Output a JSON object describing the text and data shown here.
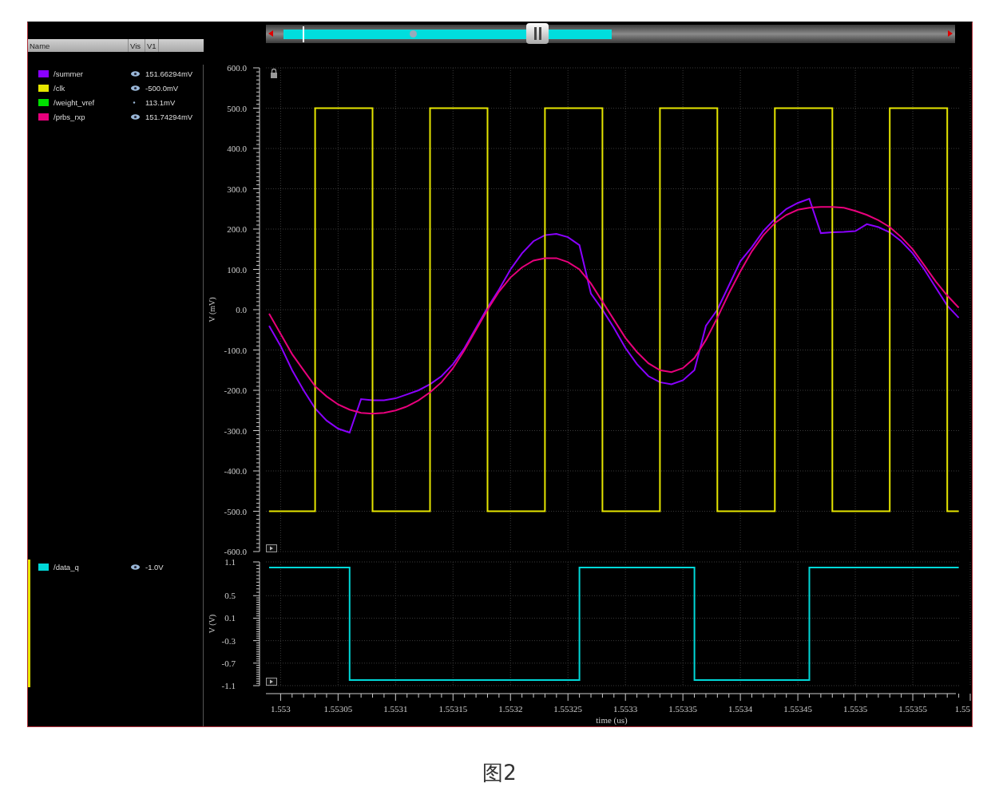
{
  "figure": {
    "legend": {
      "columns": [
        "Name",
        "Vis",
        "V1"
      ],
      "groups": [
        {
          "selected": false,
          "signals": [
            {
              "name": "/summer",
              "color": "#8a00ff",
              "visible": true,
              "value": "151.66294mV"
            },
            {
              "name": "/clk",
              "color": "#e6e600",
              "visible": true,
              "value": "-500.0mV"
            },
            {
              "name": "/weight_vref",
              "color": "#00e000",
              "visible": false,
              "value": "113.1mV"
            },
            {
              "name": "/prbs_rxp",
              "color": "#e8007c",
              "visible": true,
              "value": "151.74294mV"
            }
          ]
        },
        {
          "selected": true,
          "signals": [
            {
              "name": "/data_q",
              "color": "#00d8d8",
              "visible": true,
              "value": "-1.0V"
            }
          ]
        }
      ]
    },
    "top_chart": {
      "chart_data": {
        "type": "line",
        "grid": true,
        "ylabel": "V (mV)",
        "x": [
          1.55299,
          1.553,
          1.55301,
          1.55302,
          1.55303,
          1.55303,
          1.55304,
          1.55305,
          1.55306,
          1.55307,
          1.55308,
          1.55308,
          1.55309,
          1.5531,
          1.55311,
          1.55312,
          1.55313,
          1.55313,
          1.55314,
          1.55315,
          1.55316,
          1.55317,
          1.55318,
          1.55318,
          1.55319,
          1.5532,
          1.55321,
          1.55322,
          1.55323,
          1.55323,
          1.55324,
          1.55325,
          1.55326,
          1.55327,
          1.55328,
          1.55328,
          1.55329,
          1.5533,
          1.55331,
          1.55332,
          1.55333,
          1.55333,
          1.55334,
          1.55335,
          1.55336,
          1.55337,
          1.55338,
          1.55338,
          1.55339,
          1.5534,
          1.55341,
          1.55342,
          1.55343,
          1.55343,
          1.55344,
          1.55345,
          1.55346,
          1.55347,
          1.55348,
          1.55348,
          1.55349,
          1.5535,
          1.55351,
          1.55352,
          1.55353,
          1.55353,
          1.55354,
          1.55355,
          1.55356,
          1.55357,
          1.55358,
          1.55358,
          1.55359
        ],
        "series": [
          {
            "color": "#8a00ff",
            "values": [
              -40,
              -90,
              -150,
              -200,
              -245,
              -245,
              -275,
              -295,
              -305,
              -222,
              -225,
              -225,
              -225,
              -220,
              -210,
              -200,
              -185,
              -185,
              -165,
              -135,
              -95,
              -45,
              5,
              5,
              50,
              100,
              140,
              170,
              185,
              185,
              188,
              180,
              160,
              40,
              0,
              0,
              -45,
              -95,
              -135,
              -165,
              -180,
              -180,
              -185,
              -175,
              -150,
              -40,
              0,
              0,
              60,
              120,
              155,
              195,
              225,
              225,
              250,
              265,
              275,
              190,
              192,
              192,
              193,
              195,
              212,
              205,
              192,
              192,
              170,
              140,
              100,
              55,
              10,
              10,
              -20
            ]
          },
          {
            "color": "#e6e600",
            "values": [
              -500,
              -500,
              -500,
              -500,
              -500,
              500,
              500,
              500,
              500,
              500,
              500,
              -500,
              -500,
              -500,
              -500,
              -500,
              -500,
              500,
              500,
              500,
              500,
              500,
              500,
              -500,
              -500,
              -500,
              -500,
              -500,
              -500,
              500,
              500,
              500,
              500,
              500,
              500,
              -500,
              -500,
              -500,
              -500,
              -500,
              -500,
              500,
              500,
              500,
              500,
              500,
              500,
              -500,
              -500,
              -500,
              -500,
              -500,
              -500,
              500,
              500,
              500,
              500,
              500,
              500,
              -500,
              -500,
              -500,
              -500,
              -500,
              -500,
              500,
              500,
              500,
              500,
              500,
              500,
              -500,
              -500
            ]
          },
          {
            "color": "#e8007c",
            "values": [
              -10,
              -60,
              -110,
              -150,
              -190,
              -190,
              -215,
              -235,
              -248,
              -256,
              -258,
              -258,
              -256,
              -250,
              -240,
              -225,
              -205,
              -205,
              -180,
              -145,
              -100,
              -50,
              0,
              0,
              45,
              80,
              105,
              122,
              128,
              128,
              128,
              118,
              100,
              65,
              20,
              20,
              -25,
              -70,
              -105,
              -133,
              -150,
              -150,
              -155,
              -145,
              -120,
              -75,
              -20,
              -20,
              40,
              95,
              145,
              185,
              215,
              215,
              235,
              248,
              253,
              255,
              255,
              255,
              253,
              245,
              235,
              222,
              205,
              205,
              180,
              150,
              110,
              70,
              35,
              35,
              5
            ]
          }
        ],
        "xlim": [
          1.55299,
          1.5536
        ],
        "ylim": [
          -600,
          600
        ],
        "yticks": [
          {
            "value": 600,
            "label": "600.0"
          },
          {
            "value": 500,
            "label": "500.0"
          },
          {
            "value": 400,
            "label": "400.0"
          },
          {
            "value": 300,
            "label": "300.0"
          },
          {
            "value": 200,
            "label": "200.0"
          },
          {
            "value": 100,
            "label": "100.0"
          },
          {
            "value": 0,
            "label": "0.0"
          },
          {
            "value": -100,
            "label": "-100.0"
          },
          {
            "value": -200,
            "label": "-200.0"
          },
          {
            "value": -300,
            "label": "-300.0"
          },
          {
            "value": -400,
            "label": "-400.0"
          },
          {
            "value": -500,
            "label": "-500.0"
          },
          {
            "value": -600,
            "label": "-600.0"
          }
        ]
      }
    },
    "bottom_chart": {
      "chart_data": {
        "type": "line",
        "grid": true,
        "xlabel": "time (us)",
        "ylabel": "V (V)",
        "x": [
          1.55299,
          1.55306,
          1.55306,
          1.55326,
          1.55326,
          1.55336,
          1.55336,
          1.55346,
          1.55346,
          1.55359
        ],
        "series": [
          {
            "color": "#00d8d8",
            "values": [
              1,
              1,
              -1,
              -1,
              1,
              1,
              -1,
              -1,
              1,
              1
            ]
          }
        ],
        "xlim": [
          1.55299,
          1.5536
        ],
        "ylim": [
          -1.1,
          1.1
        ],
        "yticks": [
          1.1,
          0.5,
          0.1,
          -0.3,
          -0.7,
          -1.1
        ],
        "xticks": [
          {
            "value": 1.553,
            "label": "1.553"
          },
          {
            "value": 1.55305,
            "label": "1.55305"
          },
          {
            "value": 1.5531,
            "label": "1.5531"
          },
          {
            "value": 1.55315,
            "label": "1.55315"
          },
          {
            "value": 1.5532,
            "label": "1.5532"
          },
          {
            "value": 1.55325,
            "label": "1.55325"
          },
          {
            "value": 1.5533,
            "label": "1.5533"
          },
          {
            "value": 1.55335,
            "label": "1.55335"
          },
          {
            "value": 1.5534,
            "label": "1.5534"
          },
          {
            "value": 1.55345,
            "label": "1.55345"
          },
          {
            "value": 1.5535,
            "label": "1.5535"
          },
          {
            "value": 1.55355,
            "label": "1.55355"
          },
          {
            "value": 1.5536,
            "label": "1.55"
          }
        ]
      }
    }
  },
  "caption": "图2"
}
